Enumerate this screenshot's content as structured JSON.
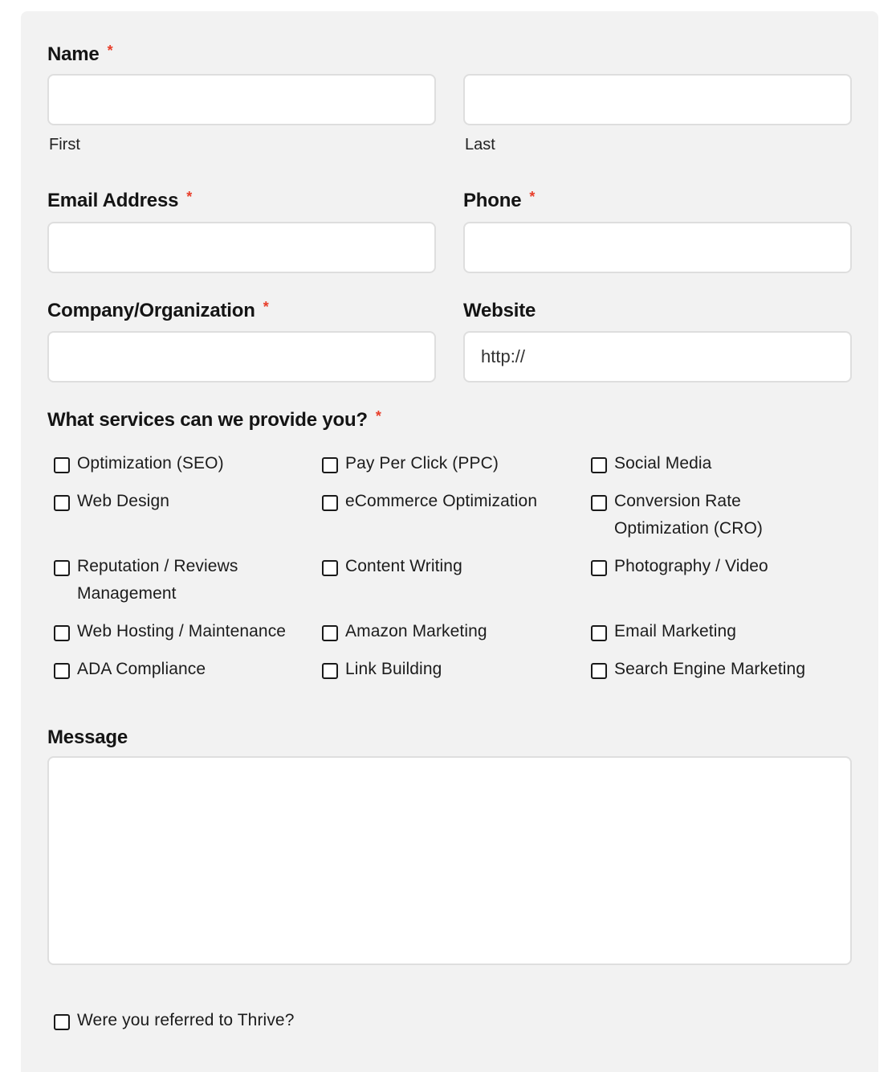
{
  "form": {
    "name": {
      "label": "Name",
      "required_marker": "*",
      "first": {
        "value": "",
        "sublabel": "First"
      },
      "last": {
        "value": "",
        "sublabel": "Last"
      }
    },
    "email": {
      "label": "Email Address",
      "required_marker": "*",
      "value": ""
    },
    "phone": {
      "label": "Phone",
      "required_marker": "*",
      "value": ""
    },
    "company": {
      "label": "Company/Organization",
      "required_marker": "*",
      "value": ""
    },
    "website": {
      "label": "Website",
      "value": "http://"
    },
    "services": {
      "label": "What services can we provide you?",
      "required_marker": "*",
      "options": [
        {
          "label": "Optimization (SEO)",
          "checked": false
        },
        {
          "label": "Pay Per Click (PPC)",
          "checked": false
        },
        {
          "label": "Social Media",
          "checked": false
        },
        {
          "label": "Web Design",
          "checked": false
        },
        {
          "label": "eCommerce Optimization",
          "checked": false
        },
        {
          "label": "Conversion Rate Optimization (CRO)",
          "checked": false
        },
        {
          "label": "Reputation / Reviews Management",
          "checked": false
        },
        {
          "label": "Content Writing",
          "checked": false
        },
        {
          "label": "Photography / Video",
          "checked": false
        },
        {
          "label": "Web Hosting / Maintenance",
          "checked": false
        },
        {
          "label": "Amazon Marketing",
          "checked": false
        },
        {
          "label": "Email Marketing",
          "checked": false
        },
        {
          "label": "ADA Compliance",
          "checked": false
        },
        {
          "label": "Link Building",
          "checked": false
        },
        {
          "label": "Search Engine Marketing",
          "checked": false
        }
      ]
    },
    "message": {
      "label": "Message",
      "value": ""
    },
    "referral": {
      "label": "Were you referred to Thrive?",
      "checked": false
    }
  },
  "colors": {
    "panel_bg": "#f2f2f2",
    "required": "#e83e2a",
    "input_border": "#dedede"
  }
}
